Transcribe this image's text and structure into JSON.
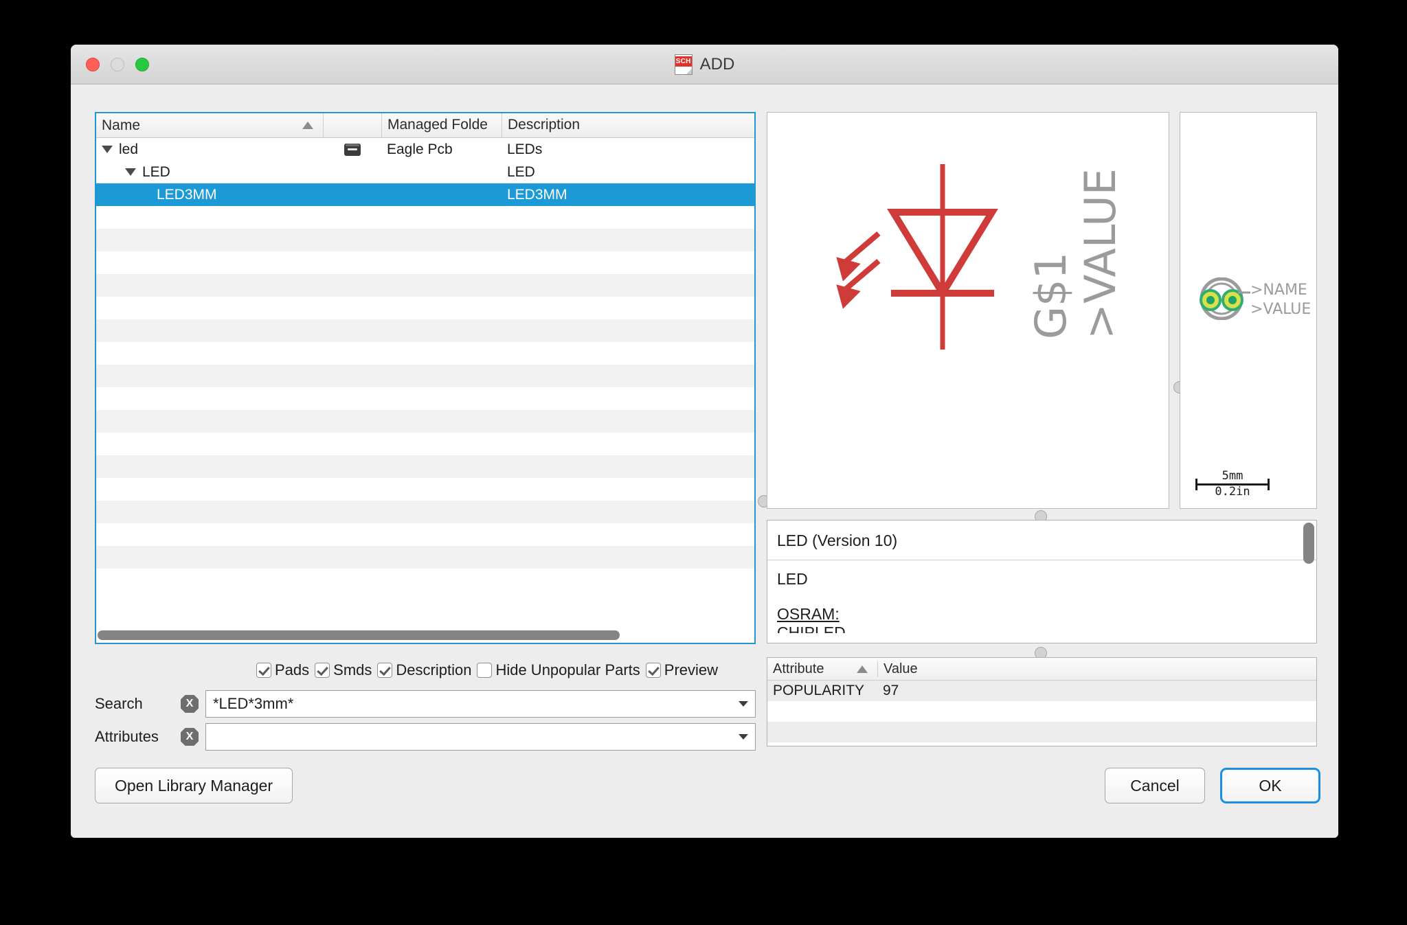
{
  "window": {
    "title": "ADD",
    "icon": "sch-document-icon",
    "icon_text": "SCH",
    "traffic_lights": [
      "close",
      "minimize",
      "maximize"
    ]
  },
  "tree": {
    "columns": [
      {
        "label": "Name",
        "sort": "ascending"
      },
      {
        "label": ""
      },
      {
        "label": "Managed Folde"
      },
      {
        "label": "Description"
      }
    ],
    "rows": [
      {
        "name": "led",
        "indent": 0,
        "expander": "collapse-triangle",
        "icon": "drawer-icon",
        "folder": "Eagle Pcb",
        "description": "LEDs",
        "selected": false
      },
      {
        "name": "LED",
        "indent": 1,
        "expander": "collapse-triangle",
        "icon": "",
        "folder": "",
        "description": "LED",
        "selected": false
      },
      {
        "name": "LED3MM",
        "indent": 2,
        "expander": "",
        "icon": "",
        "folder": "",
        "description": "LED3MM",
        "selected": true
      }
    ],
    "empty_row_count": 16
  },
  "symbol_preview": {
    "designator": "G$1",
    "value_label": ">VALUE",
    "symbol": "led-diode-symbol",
    "color": "#cf3b39"
  },
  "footprint_preview": {
    "name_label": ">NAME",
    "value_label": ">VALUE",
    "scale_metric": "5mm",
    "scale_imperial": "0.2in"
  },
  "description": {
    "title": "LED (Version 10)",
    "line1": "LED",
    "line2": "OSRAM:",
    "line3": "CHIPLED"
  },
  "attributes": {
    "columns": [
      {
        "label": "Attribute",
        "sort": "ascending"
      },
      {
        "label": "Value"
      }
    ],
    "rows": [
      {
        "attribute": "POPULARITY",
        "value": "97"
      }
    ],
    "empty_row_count": 3
  },
  "options": [
    {
      "label": "Pads",
      "checked": true
    },
    {
      "label": "Smds",
      "checked": true
    },
    {
      "label": "Description",
      "checked": true
    },
    {
      "label": "Hide Unpopular Parts",
      "checked": false
    },
    {
      "label": "Preview",
      "checked": true
    }
  ],
  "search": {
    "label": "Search",
    "value": "*LED*3mm*",
    "clear": "X"
  },
  "attributes_filter": {
    "label": "Attributes",
    "value": "",
    "clear": "X"
  },
  "buttons": {
    "library_manager": "Open Library Manager",
    "cancel": "Cancel",
    "ok": "OK"
  }
}
